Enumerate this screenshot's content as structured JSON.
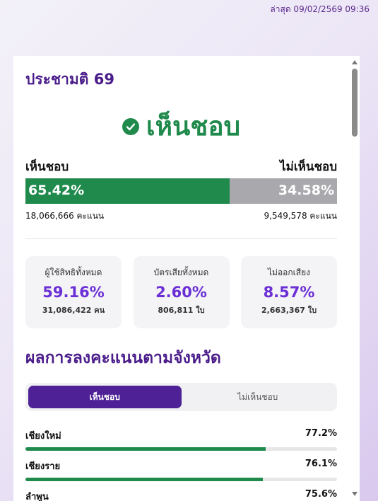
{
  "updated": "ล่าสุด 09/02/2569 09:36",
  "card": {
    "title": "ประชามติ 69",
    "result": "เห็นชอบ",
    "result_icon": "check-circle-icon",
    "yes_label": "เห็นชอบ",
    "no_label": "ไม่เห็นชอบ",
    "yes_percent": "65.42%",
    "no_percent": "34.58%",
    "yes_fraction": 0.6542,
    "yes_count": "18,066,666 คะแนน",
    "no_count": "9,549,578 คะแนน"
  },
  "stats": [
    {
      "label": "ผู้ใช้สิทธิทั้งหมด",
      "value": "59.16%",
      "sub": "31,086,422 คน"
    },
    {
      "label": "บัตรเสียทั้งหมด",
      "value": "2.60%",
      "sub": "806,811 ใบ"
    },
    {
      "label": "ไม่ออกเสียง",
      "value": "8.57%",
      "sub": "2,663,367 ใบ"
    }
  ],
  "provinces_section": {
    "title": "ผลการลงคะแนนตามจังหวัด",
    "tabs": [
      "เห็นชอบ",
      "ไม่เห็นชอบ"
    ],
    "active_tab": 0,
    "items": [
      {
        "name": "เชียงใหม่",
        "percent": "77.2%",
        "fraction": 0.772
      },
      {
        "name": "เชียงราย",
        "percent": "76.1%",
        "fraction": 0.761
      },
      {
        "name": "ลำพูน",
        "percent": "75.6%",
        "fraction": 0.756
      }
    ]
  },
  "colors": {
    "accent": "#4a1d8a",
    "yes": "#1f8a4c",
    "no": "#a9a9ad",
    "stat_value": "#6b2fd6"
  }
}
